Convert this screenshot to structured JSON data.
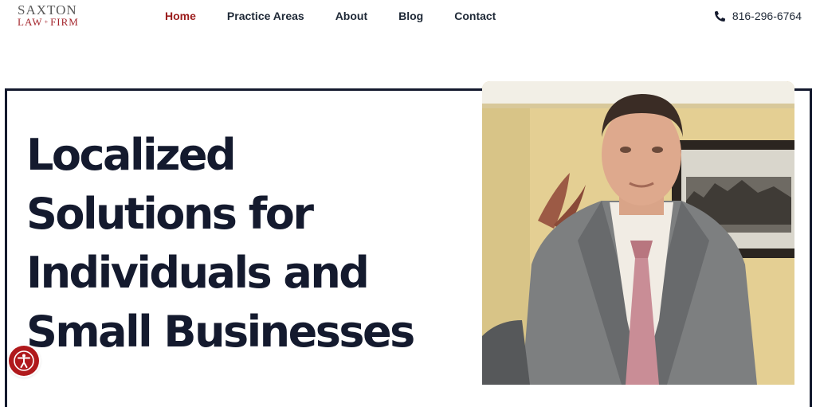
{
  "logo": {
    "line1": "SAXTON",
    "line2_left": "LAW",
    "line2_sep": "+",
    "line2_right": "FIRM"
  },
  "nav": {
    "items": [
      {
        "label": "Home",
        "active": true
      },
      {
        "label": "Practice Areas",
        "active": false
      },
      {
        "label": "About",
        "active": false
      },
      {
        "label": "Blog",
        "active": false
      },
      {
        "label": "Contact",
        "active": false
      }
    ]
  },
  "phone": {
    "number": "816-296-6764",
    "icon": "phone-icon"
  },
  "hero": {
    "title_lines": [
      "Localized",
      "Solutions for",
      "Individuals and",
      "Small Businesses"
    ],
    "image_icon": "attorney-portrait-photo"
  },
  "accessibility": {
    "icon": "accessibility-icon"
  },
  "colors": {
    "brand_red": "#9b1c1c",
    "navy": "#141a2e",
    "text": "#1f2937"
  }
}
